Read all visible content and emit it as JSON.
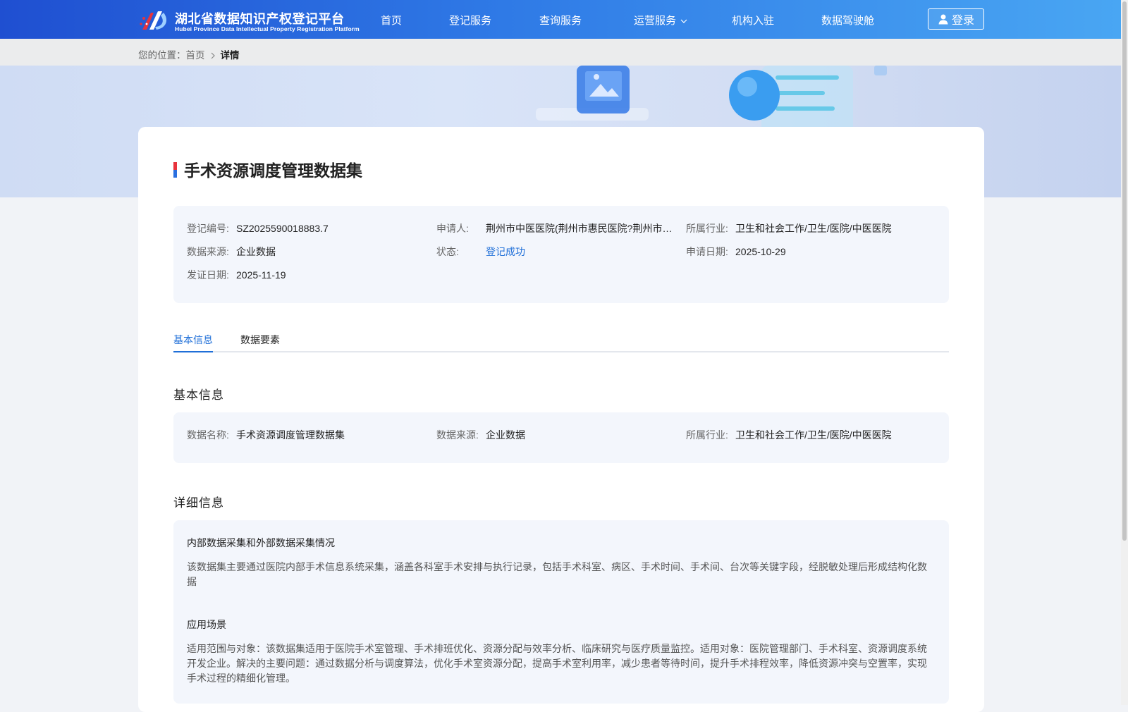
{
  "header": {
    "logo_title": "湖北省数据知识产权登记平台",
    "logo_subtitle": "Hubei Province Data Intellectual Property Registration Platform",
    "nav": [
      {
        "label": "首页"
      },
      {
        "label": "登记服务"
      },
      {
        "label": "查询服务"
      },
      {
        "label": "运营服务"
      },
      {
        "label": "机构入驻"
      },
      {
        "label": "数据驾驶舱"
      }
    ],
    "login_label": "登录"
  },
  "breadcrumb": {
    "prefix": "您的位置：",
    "home": "首页",
    "current": "详情"
  },
  "title": "手术资源调度管理数据集",
  "summary": {
    "registration_no": {
      "label": "登记编号:",
      "value": "SZ2025590018883.7"
    },
    "applicant": {
      "label": "申请人:",
      "value": "荆州市中医医院(荆州市惠民医院?荆州市中西医结合医院)"
    },
    "industry": {
      "label": "所属行业:",
      "value": "卫生和社会工作/卫生/医院/中医医院"
    },
    "data_source": {
      "label": "数据来源:",
      "value": "企业数据"
    },
    "status": {
      "label": "状态:",
      "value": "登记成功"
    },
    "apply_date": {
      "label": "申请日期:",
      "value": "2025-10-29"
    },
    "issue_date": {
      "label": "发证日期:",
      "value": "2025-11-19"
    }
  },
  "tabs": [
    {
      "label": "基本信息",
      "active": true
    },
    {
      "label": "数据要素",
      "active": false
    }
  ],
  "basic_info": {
    "section_title": "基本信息",
    "data_name": {
      "label": "数据名称:",
      "value": "手术资源调度管理数据集"
    },
    "data_source": {
      "label": "数据来源:",
      "value": "企业数据"
    },
    "industry": {
      "label": "所属行业:",
      "value": "卫生和社会工作/卫生/医院/中医医院"
    }
  },
  "detail_info": {
    "section_title": "详细信息",
    "collection_heading": "内部数据采集和外部数据采集情况",
    "collection_text": "该数据集主要通过医院内部手术信息系统采集，涵盖各科室手术安排与执行记录，包括手术科室、病区、手术时间、手术间、台次等关键字段，经脱敏处理后形成结构化数据",
    "scenario_heading": "应用场景",
    "scenario_text": "适用范围与对象：该数据集适用于医院手术室管理、手术排班优化、资源分配与效率分析、临床研究与医疗质量监控。适用对象：医院管理部门、手术科室、资源调度系统开发企业。解决的主要问题：通过数据分析与调度算法，优化手术室资源分配，提高手术室利用率，减少患者等待时间，提升手术排程效率，降低资源冲突与空置率，实现手术过程的精细化管理。"
  },
  "colors": {
    "header_start": "#1f4fd1",
    "header_end": "#49a6f3",
    "accent": "#1f6fd8",
    "panel_bg": "#f3f6fc",
    "title_mark_red": "#e8333c",
    "title_mark_blue": "#2a6fe0"
  }
}
